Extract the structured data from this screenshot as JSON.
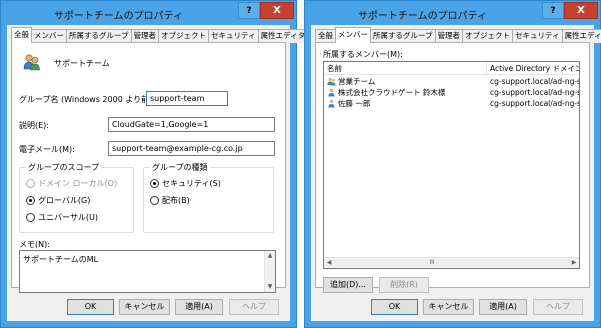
{
  "left": {
    "title": "サポートチームのプロパティ",
    "help_btn": "?",
    "close_btn": "X",
    "tabs": [
      "全般",
      "メンバー",
      "所属するグループ",
      "管理者",
      "オブジェクト",
      "セキュリティ",
      "属性エディター"
    ],
    "group_display_name": "サポートチーム",
    "fields": {
      "pre2000_label": "グループ名 (Windows 2000 より前)(W):",
      "pre2000_value": "support-team",
      "desc_label": "説明(E):",
      "desc_value": "CloudGate=1,Google=1",
      "email_label": "電子メール(M):",
      "email_value": "support-team@example-cg.co.jp"
    },
    "scope": {
      "title": "グループのスコープ",
      "options": [
        "ドメイン ローカル(O)",
        "グローバル(G)",
        "ユニバーサル(U)"
      ]
    },
    "type": {
      "title": "グループの種類",
      "options": [
        "セキュリティ(S)",
        "配布(B)"
      ]
    },
    "memo_label": "メモ(N):",
    "memo_value": "サポートチームのML",
    "buttons": {
      "ok": "OK",
      "cancel": "キャンセル",
      "apply": "適用(A)",
      "help": "ヘルプ"
    }
  },
  "right": {
    "title": "サポートチームのプロパティ",
    "help_btn": "?",
    "close_btn": "X",
    "tabs": [
      "全般",
      "メンバー",
      "所属するグループ",
      "管理者",
      "オブジェクト",
      "セキュリティ",
      "属性エディター"
    ],
    "members_label": "所属するメンバー(M):",
    "columns": [
      "名前",
      "Active Directory ドメイン サービス フォルダー"
    ],
    "rows": [
      {
        "name": "営業チーム",
        "folder": "cg-support.local/ad-ng-sup.isr.co.jp/東京",
        "icon": "group-icon"
      },
      {
        "name": "株式会社クラウドゲート 鈴木様",
        "folder": "cg-support.local/ad-ng-sup.isr.co.jp/東京",
        "icon": "user-icon"
      },
      {
        "name": "佐藤 一郎",
        "folder": "cg-support.local/ad-ng-sup.isr.co.jp/東京",
        "icon": "user-icon"
      }
    ],
    "scroll_thumb": "III",
    "add_btn": "追加(D)...",
    "remove_btn": "削除(R)",
    "buttons": {
      "ok": "OK",
      "cancel": "キャンセル",
      "apply": "適用(A)",
      "help": "ヘルプ"
    }
  }
}
